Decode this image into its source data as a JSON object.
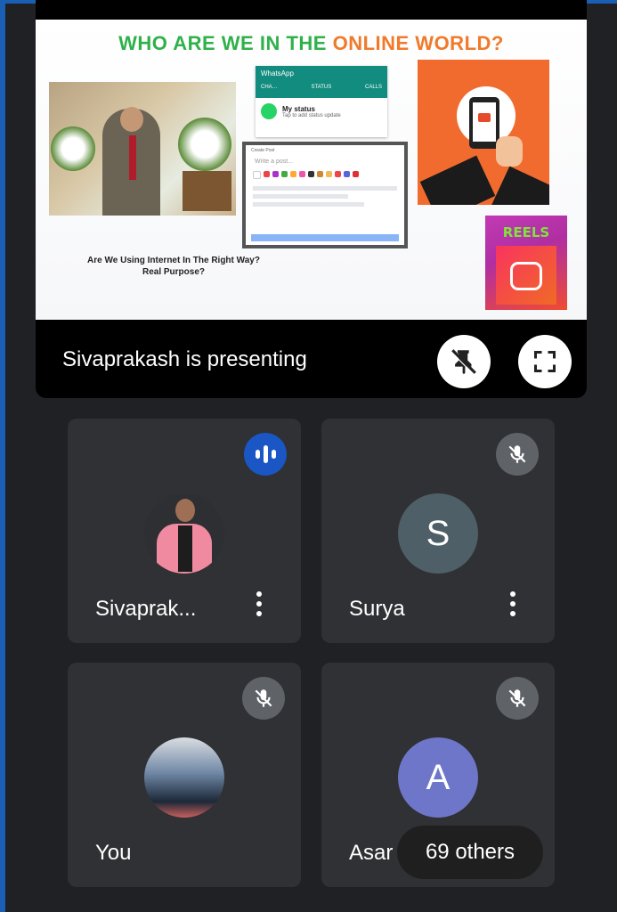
{
  "presentation": {
    "slide": {
      "title_part1": "WHO ARE WE IN THE",
      "title_part2": "ONLINE WORLD?",
      "whatsapp": {
        "app_name": "WhatsApp",
        "tabs": [
          "CHA…",
          "STATUS",
          "CALLS"
        ],
        "status_title": "My status",
        "status_subtitle": "Tap to add status update"
      },
      "post_card": {
        "header": "Create Post",
        "placeholder": "Write a post..."
      },
      "reels_label": "REELS",
      "caption_line1": "Are We Using Internet In The Right Way?",
      "caption_line2": "Real Purpose?"
    },
    "presenting_label": "Sivaprakash is presenting",
    "pin_icon": "pin-off-icon",
    "fullscreen_icon": "fullscreen-icon"
  },
  "participants": [
    {
      "name": "Sivaprak...",
      "avatar": "photo",
      "status_icon": "speaking-icon"
    },
    {
      "name": "Surya",
      "avatar_letter": "S",
      "status_icon": "mic-off-icon"
    },
    {
      "name": "You",
      "avatar": "photo",
      "status_icon": "mic-off-icon"
    },
    {
      "name": "Asar",
      "avatar_letter": "A",
      "status_icon": "mic-off-icon"
    }
  ],
  "others_label": "69 others",
  "colors": {
    "background": "#202124",
    "tile": "#303134",
    "speaking_badge": "#1a56c4",
    "mic_off_badge": "#5f6368",
    "avatar_s": "#4e5f68",
    "avatar_a": "#6e76c9",
    "title_green": "#2fb14a",
    "title_orange": "#f07a2a"
  }
}
